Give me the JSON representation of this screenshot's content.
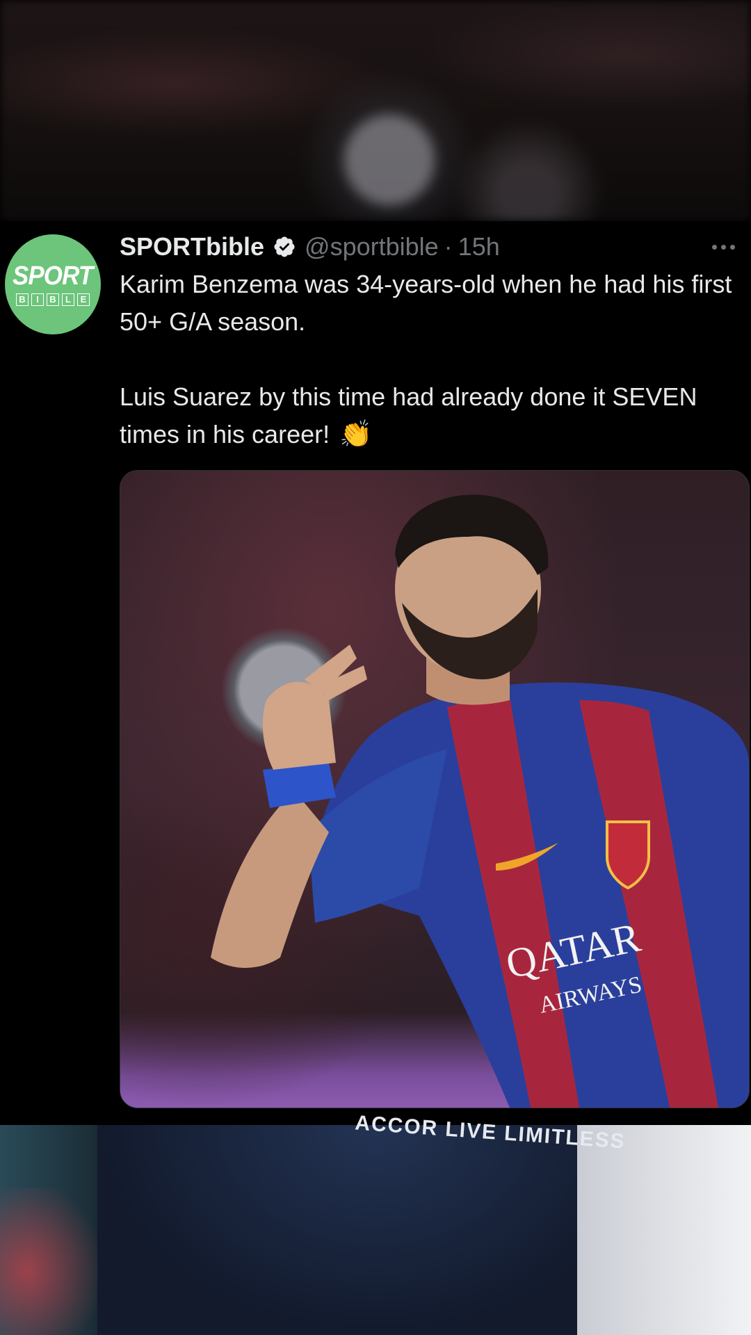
{
  "tweet": {
    "display_name": "SPORTbible",
    "handle": "@sportbible",
    "separator": "·",
    "time": "15h",
    "avatar_text": {
      "top": "SPORT",
      "bottom": [
        "B",
        "I",
        "B",
        "L",
        "E"
      ]
    },
    "lines": [
      "Karim Benzema was 34-years-old when he had his first 50+ G/A season.",
      "Luis Suarez by this time had already done it SEVEN times in his career!"
    ],
    "emoji": "👏"
  },
  "media": {
    "jersey_text_1": "QATAR",
    "jersey_text_2": "AIRWAYS"
  },
  "background": {
    "sponsor_text": "ACCOR LIVE LIMITLESS"
  },
  "colors": {
    "avatar_bg": "#6cc57a",
    "verified": "#e7e9ea",
    "secondary_text": "#71767b"
  },
  "icons": [
    "verified-badge-icon",
    "more-options-icon",
    "clapping-hands-icon"
  ]
}
